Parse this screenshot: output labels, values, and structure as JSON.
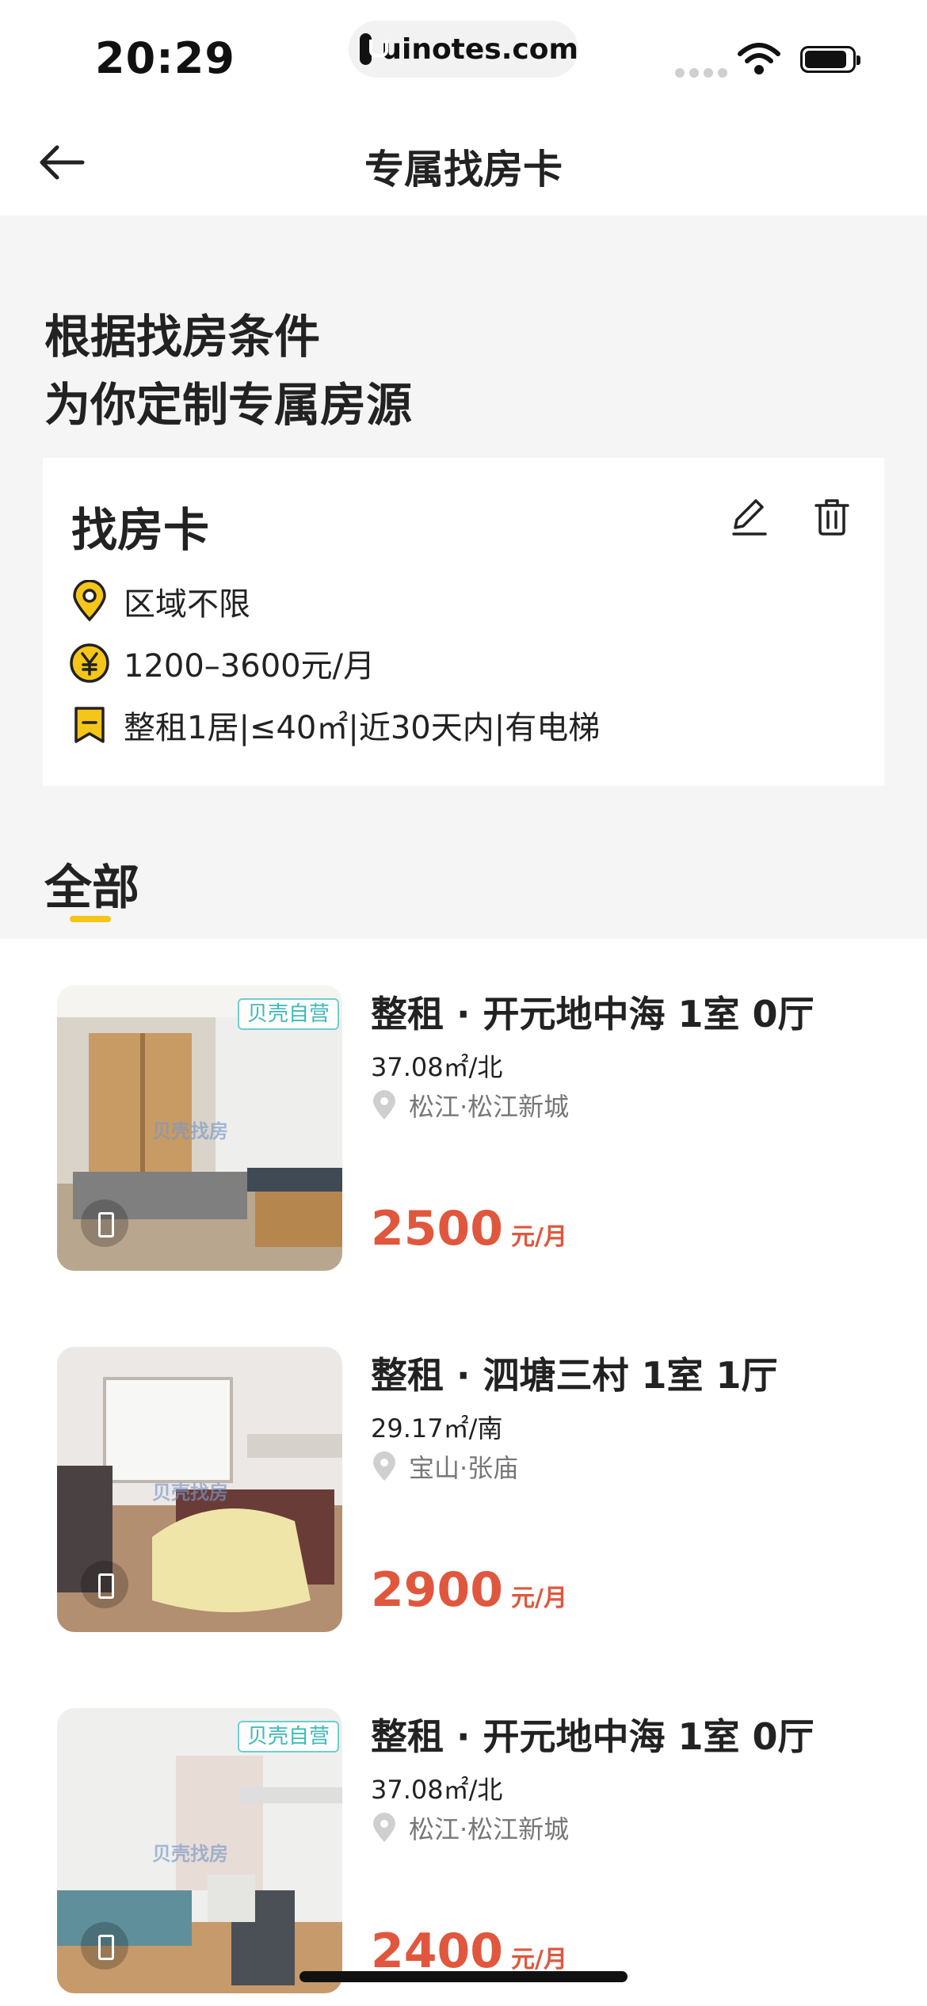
{
  "status_bar": {
    "time": "20:29",
    "url": "uinotes.com"
  },
  "nav": {
    "title": "专属找房卡"
  },
  "headline": {
    "line1": "根据找房条件",
    "line2": "为你定制专属房源"
  },
  "card": {
    "title": "找房卡",
    "criteria": [
      {
        "icon": "location-pin-icon",
        "text": "区域不限"
      },
      {
        "icon": "yen-coin-icon",
        "text": "1200–3600元/月"
      },
      {
        "icon": "bookmark-icon",
        "text": "整租1居|≤40㎡|近30天内|有电梯"
      }
    ]
  },
  "tabs": {
    "all": "全部"
  },
  "listings": [
    {
      "badge": "贝壳自营",
      "watermark": "贝壳找房",
      "title": "整租 · 开元地中海 1室 0厅",
      "meta": "37.08㎡/北",
      "location": "松江·松江新城",
      "price": "2500",
      "price_unit": "元/月"
    },
    {
      "badge": "",
      "watermark": "贝壳找房",
      "title": "整租 · 泗塘三村 1室 1厅",
      "meta": "29.17㎡/南",
      "location": "宝山·张庙",
      "price": "2900",
      "price_unit": "元/月"
    },
    {
      "badge": "贝壳自营",
      "watermark": "贝壳找房",
      "title": "整租 · 开元地中海 1室 0厅",
      "meta": "37.08㎡/北",
      "location": "松江·松江新城",
      "price": "2400",
      "price_unit": "元/月"
    }
  ],
  "colors": {
    "accent": "#f5c518",
    "price": "#e0573e",
    "badge": "#3fb9b9"
  }
}
